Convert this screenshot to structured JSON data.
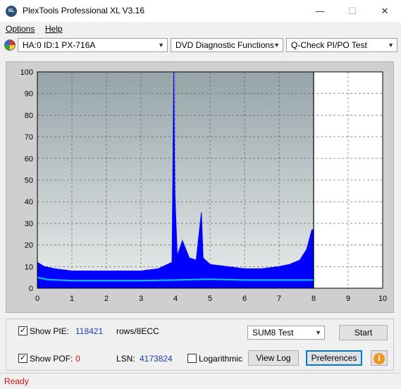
{
  "window": {
    "title": "PlexTools Professional XL V3.16",
    "icon": "xl-logo-icon",
    "app_icon_text": "XL"
  },
  "menu": [
    {
      "label": "Options",
      "key": "O"
    },
    {
      "label": "Help",
      "key": "H"
    }
  ],
  "toolbar": {
    "drive": "HA:0 ID:1  PX-716A",
    "function": "DVD Diagnostic Functions",
    "test": "Q-Check PI/PO Test"
  },
  "colors": {
    "pie": "#0000ff",
    "pie_avg": "#00ccff",
    "cursor": "#000000",
    "status": "#d01010"
  },
  "chart_data": {
    "type": "area",
    "xlim": [
      0,
      10
    ],
    "ylim": [
      0,
      100
    ],
    "x_ticks": [
      0,
      1,
      2,
      3,
      4,
      5,
      6,
      7,
      8,
      9,
      10
    ],
    "y_ticks": [
      0,
      10,
      20,
      30,
      40,
      50,
      60,
      70,
      80,
      90,
      100
    ],
    "grid": true,
    "cursor_x": 8.0,
    "series": [
      {
        "x": [
          0,
          0.2,
          0.5,
          1.0,
          1.5,
          2.0,
          2.5,
          3.0,
          3.5,
          3.9,
          3.95,
          3.98,
          4.05,
          4.2,
          4.4,
          4.6,
          4.75,
          4.8,
          5.0,
          5.5,
          6.0,
          6.5,
          7.0,
          7.3,
          7.6,
          7.8,
          7.95,
          8.0
        ],
        "values": [
          12,
          10,
          9,
          8,
          8,
          8,
          8,
          8,
          9,
          12,
          100,
          45,
          15,
          22,
          14,
          13,
          35,
          14,
          11,
          10,
          9,
          9,
          10,
          11,
          13,
          18,
          27,
          27
        ]
      },
      {
        "x": [
          0,
          0.3,
          1.0,
          2.0,
          3.0,
          4.0,
          5.0,
          6.0,
          7.0,
          8.0
        ],
        "values": [
          5,
          4,
          3.5,
          3.5,
          3.5,
          3.8,
          4.2,
          3.8,
          3.8,
          3.8
        ]
      }
    ]
  },
  "panel": {
    "show_pie_label": "Show PIE:",
    "pie_value": "118421",
    "pie_unit": "rows/8ECC",
    "show_pof_label": "Show POF:",
    "pof_value": "0",
    "lsn_label": "LSN:",
    "lsn_value": "4173824",
    "log_label": "Logarithmic",
    "sum_test": "SUM8 Test",
    "start_button": "Start",
    "viewlog_button": "View Log",
    "prefs_button": "Preferences"
  },
  "status": "Ready"
}
